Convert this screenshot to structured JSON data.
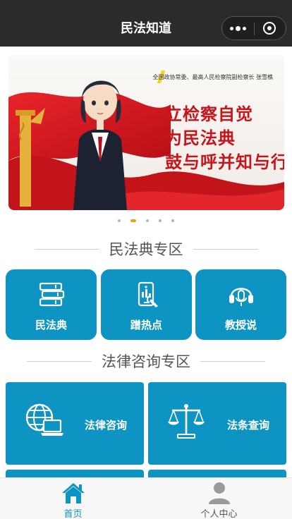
{
  "app": {
    "title": "民法知道"
  },
  "banner": {
    "quote": "全国政协常委、最高人民检察院副检察长 张雪樵",
    "lines": [
      "立检察自觉",
      "为民法典",
      "鼓与呼并知与行"
    ]
  },
  "carousel": {
    "count": 5,
    "active_index": 1
  },
  "section_civil": {
    "title": "民法典专区",
    "items": [
      {
        "label": "民法典",
        "icon": "books-icon"
      },
      {
        "label": "蹭热点",
        "icon": "phone-chart-icon"
      },
      {
        "label": "教授说",
        "icon": "headset-icon"
      }
    ]
  },
  "section_legal": {
    "title": "法律咨询专区",
    "items": [
      {
        "label": "法律咨询",
        "icon": "globe-laptop-icon"
      },
      {
        "label": "法条查询",
        "icon": "scales-icon"
      }
    ]
  },
  "tabbar": {
    "items": [
      {
        "label": "首页",
        "icon": "home-icon",
        "active": true
      },
      {
        "label": "个人中心",
        "icon": "user-icon",
        "active": false
      }
    ]
  },
  "colors": {
    "navbar": "#2b2b2e",
    "accent": "#0e94c3",
    "banner_text": "#c8141b",
    "dot_active": "#e8a21c"
  }
}
